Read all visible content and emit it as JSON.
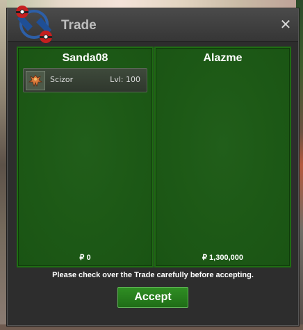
{
  "window": {
    "title": "Trade"
  },
  "trade": {
    "left": {
      "player": "Sanda08",
      "money": "₽ 0",
      "items": [
        {
          "name": "Scizor",
          "level": "Lvl: 100"
        }
      ]
    },
    "right": {
      "player": "Alazme",
      "money": "₽ 1,300,000",
      "items": []
    }
  },
  "footer": {
    "notice": "Please check over the Trade carefully before accepting.",
    "accept_label": "Accept"
  },
  "icons": {
    "logo": "pokeball-logo",
    "close": "close-icon",
    "item": "scizor-icon"
  },
  "colors": {
    "panel_green": "#1d5916",
    "accept_green": "#2f8e23",
    "titlebar": "#3d3d3d"
  }
}
